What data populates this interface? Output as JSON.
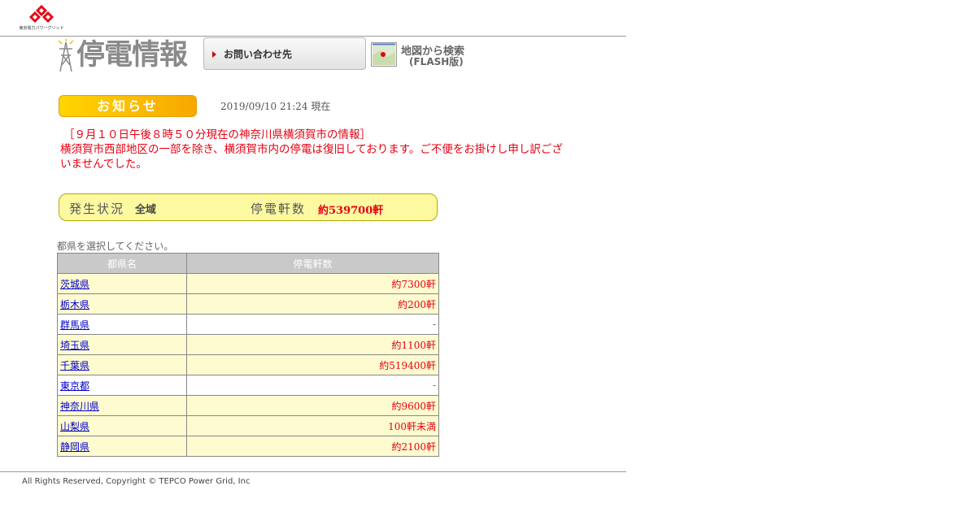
{
  "header": {
    "logo_caption": "東京電力パワーグリッド",
    "title": "停電情報",
    "contact_label": "お問い合わせ先",
    "map_search_line1": "地図から検索",
    "map_search_line2": "(FLASH版)"
  },
  "notice": {
    "badge": "お知らせ",
    "timestamp": "2019/09/10 21:24",
    "timestamp_suffix": "現在",
    "message_line1": "［９月１０日午後８時５０分現在の神奈川県横須賀市の情報］",
    "message_line2": "横須賀市西部地区の一部を除き、横須賀市内の停電は復旧しております。ご不便をお掛けし申し訳ございませんでした。"
  },
  "status": {
    "label": "発生状況",
    "area": "全域",
    "count_label": "停電軒数",
    "count": "約539700軒"
  },
  "table": {
    "prompt": "都県を選択してください。",
    "headers": [
      "都県名",
      "停電軒数"
    ],
    "rows": [
      {
        "name": "茨城県",
        "count": "約7300軒"
      },
      {
        "name": "栃木県",
        "count": "約200軒"
      },
      {
        "name": "群馬県",
        "count": "-"
      },
      {
        "name": "埼玉県",
        "count": "約1100軒"
      },
      {
        "name": "千葉県",
        "count": "約519400軒"
      },
      {
        "name": "東京都",
        "count": "-"
      },
      {
        "name": "神奈川県",
        "count": "約9600軒"
      },
      {
        "name": "山梨県",
        "count": "100軒未満"
      },
      {
        "name": "静岡県",
        "count": "約2100軒"
      }
    ]
  },
  "footer": {
    "copyright": "All Rights Reserved, Copyright © TEPCO Power Grid, Inc"
  },
  "colors": {
    "accent_red": "#e60012",
    "notice_yellow": "#ffd400",
    "status_bg": "#fdf9a1",
    "row_yellow": "#fefbd0",
    "link_blue": "#0000cc"
  },
  "icons": {
    "logo": "tepco-diamond-logo",
    "title": "transmission-tower-icon",
    "contact": "arrow-right-icon",
    "map": "map-icon"
  }
}
